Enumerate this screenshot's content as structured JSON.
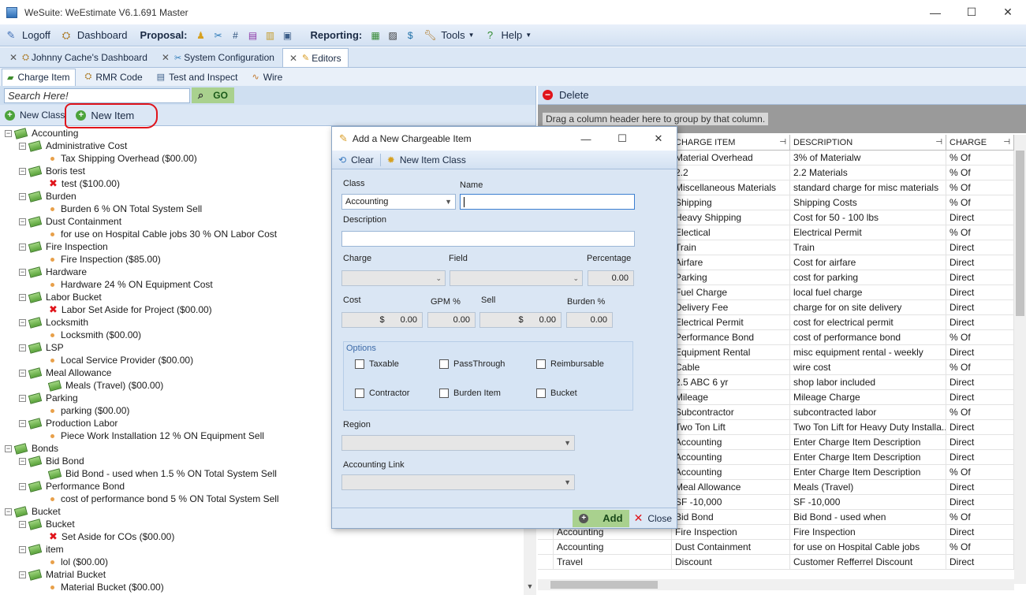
{
  "window": {
    "title": "WeSuite: WeEstimate V6.1.691 Master",
    "min": "—",
    "max": "☐",
    "close": "✕"
  },
  "toolbar": {
    "logoff": "Logoff",
    "dashboard": "Dashboard",
    "proposal": "Proposal:",
    "reporting": "Reporting:",
    "tools": "Tools",
    "help": "Help"
  },
  "doc_tabs": [
    {
      "label": "Johnny Cache's Dashboard"
    },
    {
      "label": "System Configuration"
    },
    {
      "label": "Editors"
    }
  ],
  "sub_tabs": [
    {
      "label": "Charge Item"
    },
    {
      "label": "RMR Code"
    },
    {
      "label": "Test and Inspect"
    },
    {
      "label": "Wire"
    }
  ],
  "search": {
    "placeholder": "Search Here!",
    "go": "GO"
  },
  "actions": {
    "new_class": "New Class",
    "new_item": "New Item",
    "delete": "Delete"
  },
  "tree": [
    {
      "level": 0,
      "label": "Accounting",
      "type": "class"
    },
    {
      "level": 1,
      "label": "Administrative Cost",
      "type": "group"
    },
    {
      "level": 2,
      "label": "Tax Shipping Overhead ($00.00)",
      "type": "item"
    },
    {
      "level": 1,
      "label": "Boris test",
      "type": "group"
    },
    {
      "level": 2,
      "label": "test ($100.00)",
      "type": "error"
    },
    {
      "level": 1,
      "label": "Burden",
      "type": "group"
    },
    {
      "level": 2,
      "label": "Burden 6 % ON Total System Sell",
      "type": "item"
    },
    {
      "level": 1,
      "label": "Dust Containment",
      "type": "group"
    },
    {
      "level": 2,
      "label": "for use on Hospital Cable jobs 30 % ON Labor Cost",
      "type": "item"
    },
    {
      "level": 1,
      "label": "Fire Inspection",
      "type": "group"
    },
    {
      "level": 2,
      "label": "Fire Inspection ($85.00)",
      "type": "item"
    },
    {
      "level": 1,
      "label": "Hardware",
      "type": "group"
    },
    {
      "level": 2,
      "label": "Hardware 24 % ON Equipment Cost",
      "type": "item"
    },
    {
      "level": 1,
      "label": "Labor Bucket",
      "type": "group"
    },
    {
      "level": 2,
      "label": "Labor Set Aside for Project ($00.00)",
      "type": "error"
    },
    {
      "level": 1,
      "label": "Locksmith",
      "type": "group"
    },
    {
      "level": 2,
      "label": "Locksmith ($00.00)",
      "type": "item"
    },
    {
      "level": 1,
      "label": "LSP",
      "type": "group"
    },
    {
      "level": 2,
      "label": "Local Service Provider ($00.00)",
      "type": "item"
    },
    {
      "level": 1,
      "label": "Meal Allowance",
      "type": "group"
    },
    {
      "level": 2,
      "label": "Meals (Travel) ($00.00)",
      "type": "money"
    },
    {
      "level": 1,
      "label": "Parking",
      "type": "group"
    },
    {
      "level": 2,
      "label": "parking ($00.00)",
      "type": "item"
    },
    {
      "level": 1,
      "label": "Production Labor",
      "type": "group"
    },
    {
      "level": 2,
      "label": "Piece Work Installation 12 % ON Equipment Sell",
      "type": "item"
    },
    {
      "level": 0,
      "label": "Bonds",
      "type": "class"
    },
    {
      "level": 1,
      "label": "Bid Bond",
      "type": "group"
    },
    {
      "level": 2,
      "label": "Bid Bond - used when  1.5 % ON Total System Sell",
      "type": "money"
    },
    {
      "level": 1,
      "label": "Performance Bond",
      "type": "group"
    },
    {
      "level": 2,
      "label": "cost of performance bond 5 % ON Total System Sell",
      "type": "item"
    },
    {
      "level": 0,
      "label": "Bucket",
      "type": "class"
    },
    {
      "level": 1,
      "label": "Bucket",
      "type": "group"
    },
    {
      "level": 2,
      "label": "Set Aside for COs ($00.00)",
      "type": "error"
    },
    {
      "level": 1,
      "label": "item",
      "type": "group"
    },
    {
      "level": 2,
      "label": "lol ($00.00)",
      "type": "item"
    },
    {
      "level": 1,
      "label": "Matrial Bucket",
      "type": "group"
    },
    {
      "level": 2,
      "label": "Material Bucket ($00.00)",
      "type": "item"
    }
  ],
  "grid": {
    "group_hint": "Drag a column header here to group by that column.",
    "columns": [
      "",
      "CHARGE ITEM",
      "DESCRIPTION",
      "CHARGE"
    ],
    "rows": [
      [
        "",
        "Material Overhead",
        "3% of Materialw",
        "% Of"
      ],
      [
        "",
        "2.2",
        "2.2 Materials",
        "% Of"
      ],
      [
        "",
        "Miscellaneous Materials",
        "standard charge for misc materials",
        "% Of"
      ],
      [
        "",
        "Shipping",
        "Shipping Costs",
        "% Of"
      ],
      [
        "",
        "Heavy Shipping",
        "Cost for 50 - 100 lbs",
        "Direct"
      ],
      [
        "",
        "Electical",
        "Electrical Permit",
        "% Of"
      ],
      [
        "",
        "Train",
        "Train",
        "Direct"
      ],
      [
        "",
        "Airfare",
        "Cost for airfare",
        "Direct"
      ],
      [
        "",
        "Parking",
        "cost for parking",
        "Direct"
      ],
      [
        "",
        "Fuel Charge",
        "local fuel charge",
        "Direct"
      ],
      [
        "",
        "Delivery Fee",
        "charge for on site delivery",
        "Direct"
      ],
      [
        "",
        "Electrical Permit",
        "cost for electrical permit",
        "Direct"
      ],
      [
        "",
        "Performance Bond",
        "cost of performance bond",
        "% Of"
      ],
      [
        "",
        "Equipment Rental",
        "misc equipment rental - weekly",
        "Direct"
      ],
      [
        "",
        "Cable",
        "wire cost",
        "% Of"
      ],
      [
        "",
        "2.5 ABC 6 yr",
        "shop labor included",
        "Direct"
      ],
      [
        "",
        "Mileage",
        "Mileage Charge",
        "Direct"
      ],
      [
        "",
        "Subcontractor",
        "subcontracted labor",
        "% Of"
      ],
      [
        "",
        "Two Ton Lift",
        "Two Ton Lift for Heavy Duty Installa...",
        "Direct"
      ],
      [
        "",
        "Accounting",
        "Enter Charge Item Description",
        "Direct"
      ],
      [
        "",
        "Accounting",
        "Enter Charge Item Description",
        "Direct"
      ],
      [
        "",
        "Accounting",
        "Enter Charge Item Description",
        "% Of"
      ],
      [
        "",
        "Meal Allowance",
        "Meals (Travel)",
        "Direct"
      ],
      [
        "",
        "SF -10,000",
        "SF -10,000",
        "Direct"
      ],
      [
        "",
        "Bid Bond",
        "Bid Bond - used when",
        "% Of"
      ],
      [
        "Accounting",
        "Fire Inspection",
        "Fire Inspection",
        "Direct"
      ],
      [
        "Accounting",
        "Dust Containment",
        "for use on Hospital Cable jobs",
        "% Of"
      ],
      [
        "Travel",
        "Discount",
        "Customer Refferrel Discount",
        "Direct"
      ]
    ]
  },
  "dialog": {
    "title": "Add a New Chargeable Item",
    "clear": "Clear",
    "new_item_class": "New Item Class",
    "class_label": "Class",
    "class_value": "Accounting",
    "name_label": "Name",
    "description_label": "Description",
    "charge_label": "Charge",
    "field_label": "Field",
    "percentage_label": "Percentage",
    "percentage_value": "0.00",
    "cost_label": "Cost",
    "cost_currency": "$",
    "cost_value": "0.00",
    "gpm_label": "GPM %",
    "gpm_value": "0.00",
    "sell_label": "Sell",
    "sell_currency": "$",
    "sell_value": "0.00",
    "burden_label": "Burden %",
    "burden_value": "0.00",
    "options_label": "Options",
    "options": [
      "Taxable",
      "PassThrough",
      "Reimbursable",
      "Contractor",
      "Burden Item",
      "Bucket"
    ],
    "region_label": "Region",
    "accounting_link_label": "Accounting Link",
    "add": "Add",
    "close": "Close"
  }
}
